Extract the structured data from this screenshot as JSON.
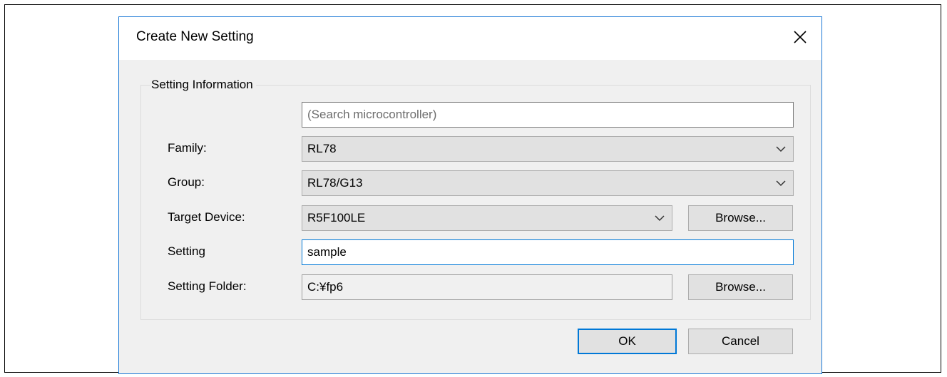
{
  "dialog": {
    "title": "Create New Setting",
    "close_icon": "close-icon",
    "accent_color": "#0078d7"
  },
  "group": {
    "legend": "Setting Information"
  },
  "search": {
    "placeholder": "(Search microcontroller)",
    "value": ""
  },
  "family": {
    "label": "Family:",
    "value": "RL78"
  },
  "group_select": {
    "label": "Group:",
    "value": "RL78/G13"
  },
  "target_device": {
    "label": "Target Device:",
    "value": "R5F100LE",
    "browse_label": "Browse..."
  },
  "setting": {
    "label": "Setting",
    "value": "sample"
  },
  "setting_folder": {
    "label": "Setting Folder:",
    "value": "C:¥fp6",
    "browse_label": "Browse..."
  },
  "footer": {
    "ok_label": "OK",
    "cancel_label": "Cancel"
  }
}
